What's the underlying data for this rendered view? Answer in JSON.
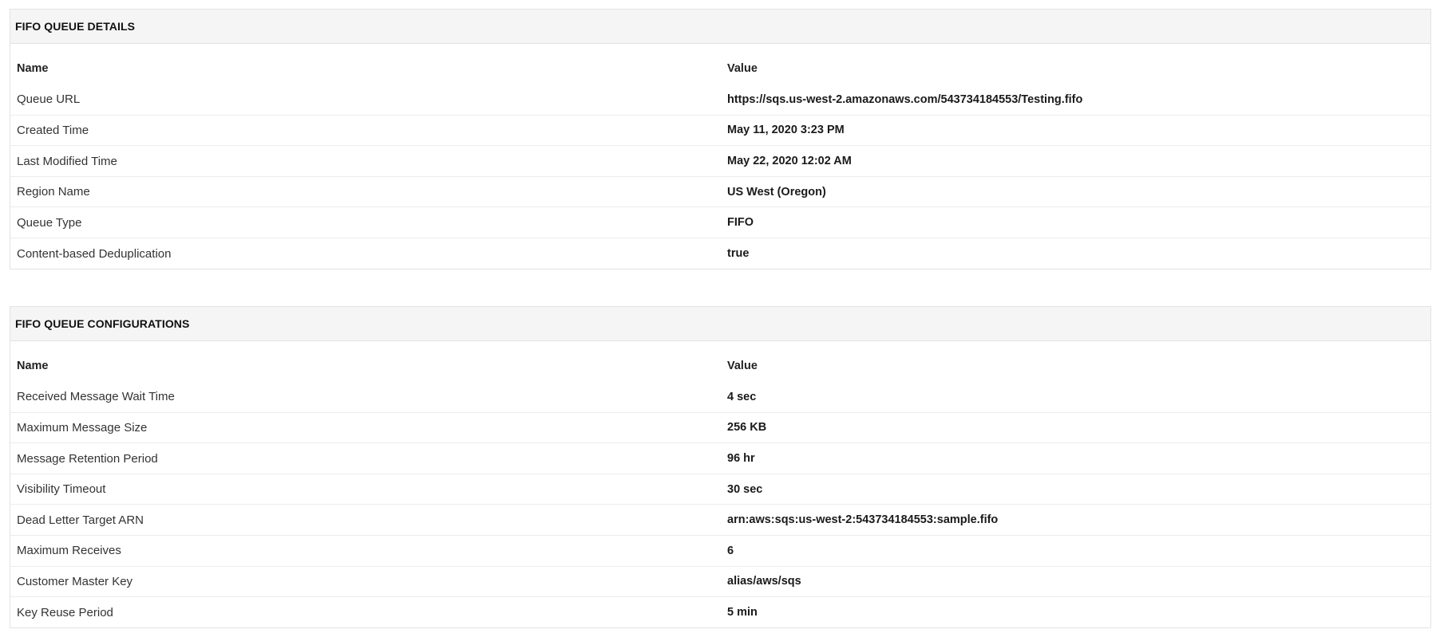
{
  "details": {
    "title": "FIFO QUEUE DETAILS",
    "columns": {
      "name": "Name",
      "value": "Value"
    },
    "rows": [
      {
        "name": "Queue URL",
        "value": "https://sqs.us-west-2.amazonaws.com/543734184553/Testing.fifo"
      },
      {
        "name": "Created Time",
        "value": "May 11, 2020 3:23 PM"
      },
      {
        "name": "Last Modified Time",
        "value": "May 22, 2020 12:02 AM"
      },
      {
        "name": "Region Name",
        "value": "US West (Oregon)"
      },
      {
        "name": "Queue Type",
        "value": "FIFO"
      },
      {
        "name": "Content-based Deduplication",
        "value": "true"
      }
    ]
  },
  "configurations": {
    "title": "FIFO QUEUE CONFIGURATIONS",
    "columns": {
      "name": "Name",
      "value": "Value"
    },
    "rows": [
      {
        "name": "Received Message Wait Time",
        "value": "4 sec"
      },
      {
        "name": "Maximum Message Size",
        "value": "256 KB"
      },
      {
        "name": "Message Retention Period",
        "value": "96 hr"
      },
      {
        "name": "Visibility Timeout",
        "value": "30 sec"
      },
      {
        "name": "Dead Letter Target ARN",
        "value": "arn:aws:sqs:us-west-2:543734184553:sample.fifo"
      },
      {
        "name": "Maximum Receives",
        "value": "6"
      },
      {
        "name": "Customer Master Key",
        "value": "alias/aws/sqs"
      },
      {
        "name": "Key Reuse Period",
        "value": "5 min"
      }
    ]
  }
}
